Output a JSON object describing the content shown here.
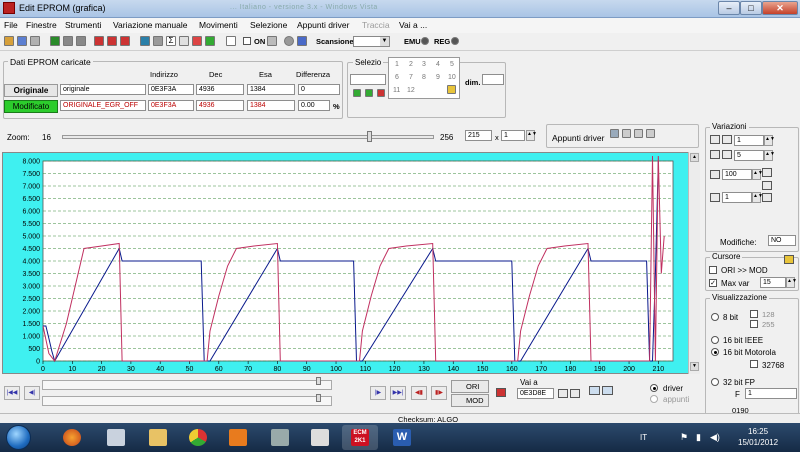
{
  "window": {
    "title": "Edit EPROM (grafica)",
    "background_title": "... Italiano - versione 3.x - Windows Vista"
  },
  "menu": [
    "File",
    "Finestre",
    "Strumenti",
    "Variazione manuale",
    "Movimenti",
    "Selezione",
    "Appunti driver",
    "Traccia",
    "Vai a ..."
  ],
  "toolbar": {
    "on_label": "ON",
    "scansione_label": "Scansione",
    "emu_label": "EMU",
    "reg_label": "REG"
  },
  "dati_eprom": {
    "title": "Dati EPROM caricate",
    "headers": [
      "Indirizzo",
      "Dec",
      "Esa",
      "Differenza"
    ],
    "originale": {
      "button": "Originale",
      "name": "originale",
      "indirizzo": "0E3F3A",
      "dec": "4936",
      "esa": "1384",
      "differenza": "0"
    },
    "modificato": {
      "button": "Modificato",
      "name": "ORIGINALE_EGR_OFF",
      "indirizzo": "0E3F3A",
      "dec": "4936",
      "esa": "1384",
      "differenza": "0.00",
      "unit": "%"
    }
  },
  "selezione": {
    "title": "Selezio",
    "dim_label": "dim.",
    "popup_items": [
      "1",
      "2",
      "3",
      "4",
      "5",
      "6",
      "7",
      "8",
      "9",
      "10",
      "11",
      "12"
    ]
  },
  "zoom": {
    "label": "Zoom:",
    "min": "16",
    "max": "256",
    "value": "215",
    "x_label": "x",
    "multiplier": "1"
  },
  "appunti_driver": {
    "label": "Appunti driver"
  },
  "chart_data": {
    "type": "line",
    "xlim": [
      0,
      215
    ],
    "ylim": [
      0,
      8000
    ],
    "x_ticks": [
      0,
      10,
      20,
      30,
      40,
      50,
      60,
      70,
      80,
      90,
      100,
      110,
      120,
      130,
      140,
      150,
      160,
      170,
      180,
      190,
      200,
      210
    ],
    "y_ticks": [
      "0",
      "500",
      "1.000",
      "1.500",
      "2.000",
      "2.500",
      "3.000",
      "3.500",
      "4.000",
      "4.500",
      "5.000",
      "5.500",
      "6.000",
      "6.500",
      "7.000",
      "7.500",
      "8.000"
    ],
    "grid": true,
    "series": [
      {
        "color": "#0a1a8c",
        "x": [
          0,
          1,
          2,
          3,
          4,
          26,
          27,
          28,
          29,
          54,
          55,
          56,
          57,
          80,
          81,
          82,
          83,
          106,
          107,
          108,
          109,
          133,
          134,
          135,
          136,
          160,
          161,
          162,
          163,
          186,
          187,
          188,
          189,
          206,
          207,
          208,
          209,
          210
        ],
        "y": [
          1400,
          1400,
          900,
          400,
          0,
          4500,
          4000,
          4000,
          4000,
          4000,
          0,
          0,
          0,
          4500,
          4000,
          4000,
          4000,
          4000,
          0,
          0,
          0,
          4500,
          4000,
          4000,
          4000,
          4000,
          0,
          0,
          0,
          4500,
          4000,
          4000,
          4000,
          4000,
          0,
          0,
          3500,
          8000
        ]
      },
      {
        "color": "#c03060",
        "x": [
          0,
          2,
          4,
          8,
          11,
          14,
          20,
          26,
          27,
          56,
          57,
          60,
          63,
          66,
          72,
          80,
          81,
          108,
          109,
          112,
          115,
          118,
          124,
          133,
          134,
          162,
          163,
          166,
          169,
          172,
          178,
          186,
          187,
          207,
          208,
          209,
          210,
          211,
          212
        ],
        "y": [
          1400,
          300,
          0,
          1500,
          3000,
          4500,
          4600,
          4700,
          0,
          0,
          1200,
          2600,
          3800,
          4500,
          4600,
          4700,
          0,
          0,
          1200,
          2600,
          3800,
          4500,
          4600,
          4700,
          0,
          0,
          1200,
          2600,
          3800,
          4500,
          4600,
          4700,
          0,
          0,
          8200,
          0,
          8200,
          3500,
          5000
        ]
      }
    ]
  },
  "variazioni": {
    "title": "Variazioni",
    "fields": [
      "1",
      "5",
      "100",
      "1"
    ],
    "modifiche_label": "Modifiche:",
    "modifiche_value": "NO"
  },
  "cursore": {
    "title": "Cursore",
    "ori_mod_label": "ORI >> MOD",
    "ori_mod_checked": false,
    "max_var_label": "Max var",
    "max_var_checked": true,
    "max_var_value": "15"
  },
  "visualizzazione": {
    "title": "Visualizzazione",
    "options": [
      {
        "label": "8 bit",
        "selected": false
      },
      {
        "label": "16 bit IEEE",
        "selected": false
      },
      {
        "label": "16 bit Motorola",
        "selected": true
      },
      {
        "label": "32 bit FP",
        "selected": false
      }
    ],
    "sub_options": [
      "128",
      "255",
      "32768"
    ],
    "f_label": "F",
    "f_value": "1",
    "bottom_value": "0190"
  },
  "navigation": {
    "ori_label": "ORI",
    "mod_label": "MOD",
    "vai_a_label": "Vai a",
    "vai_a_value": "0E3D8E",
    "driver_label": "driver",
    "appunti_label": "appunti"
  },
  "status": {
    "checksum": "Checksum: ALGO"
  },
  "taskbar": {
    "language": "IT",
    "time": "16:25",
    "date": "15/01/2012",
    "ecm_label": "ECM 2K1"
  }
}
